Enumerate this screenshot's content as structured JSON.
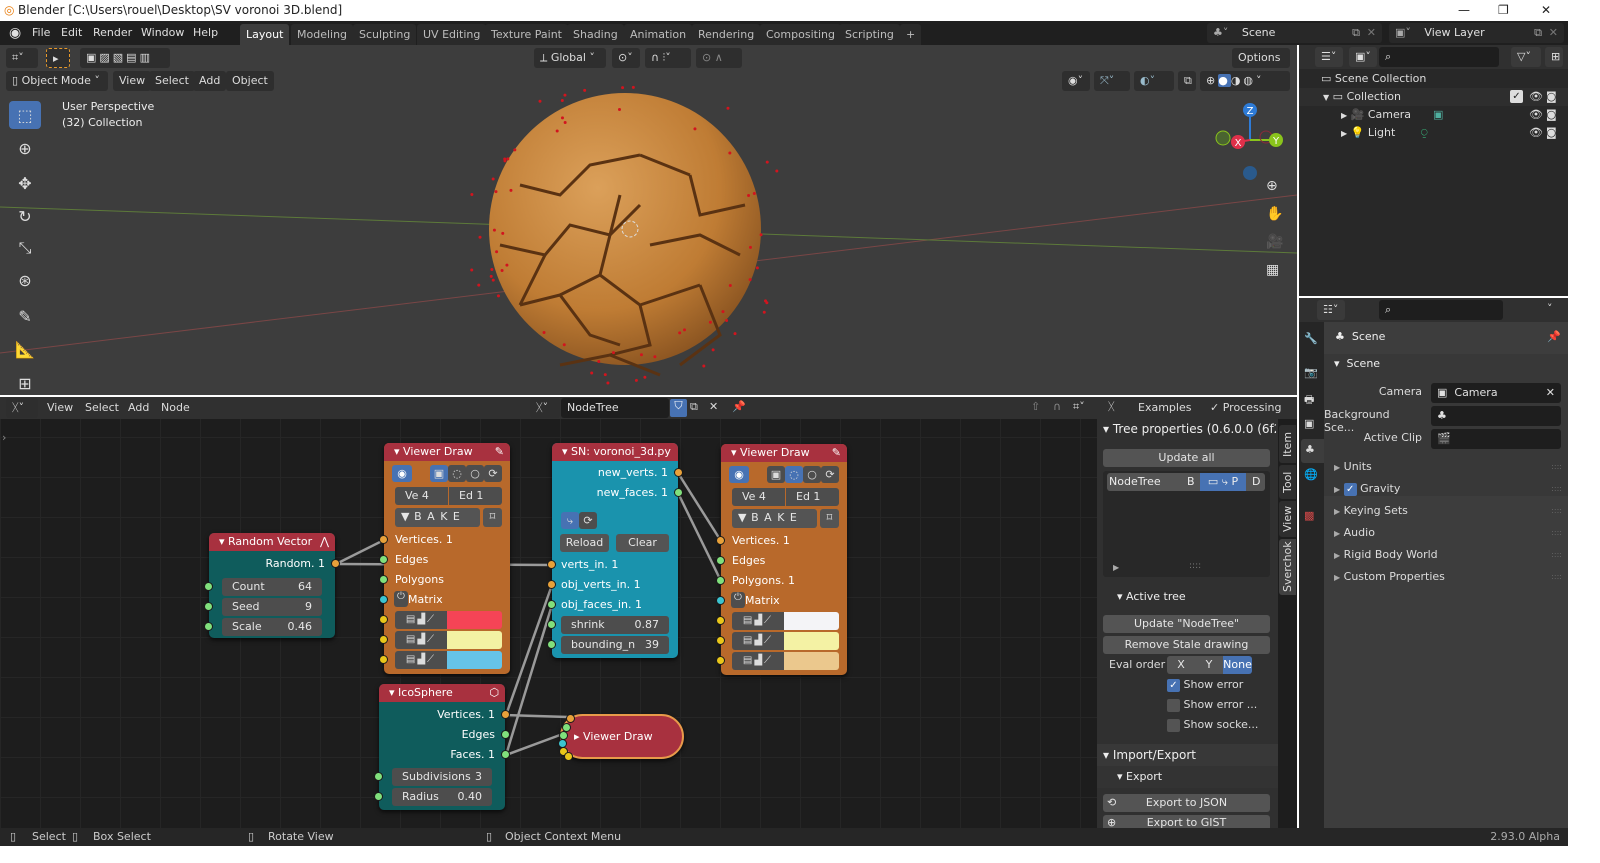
{
  "window": {
    "title": "Blender [C:\\Users\\rouel\\Desktop\\SV voronoi 3D.blend]",
    "minimize": "—",
    "restore": "❐",
    "close": "✕"
  },
  "menu": [
    "File",
    "Edit",
    "Render",
    "Window",
    "Help"
  ],
  "workspaces": [
    {
      "label": "Layout",
      "active": true
    },
    {
      "label": "Modeling"
    },
    {
      "label": "Sculpting"
    },
    {
      "label": "UV Editing"
    },
    {
      "label": "Texture Paint"
    },
    {
      "label": "Shading"
    },
    {
      "label": "Animation"
    },
    {
      "label": "Rendering"
    },
    {
      "label": "Compositing"
    },
    {
      "label": "Scripting"
    },
    {
      "label": "+"
    }
  ],
  "scene": "Scene",
  "view_layer": "View Layer",
  "viewport": {
    "transform_orientation": "Global",
    "options": "Options",
    "mode": "Object Mode",
    "menu": [
      "View",
      "Select",
      "Add",
      "Object"
    ],
    "overlay_title": "User Perspective",
    "overlay_collection": "(32) Collection",
    "gizmo": {
      "x": "X",
      "y": "Y",
      "z": "Z"
    },
    "object_color": "#c8842e"
  },
  "outliner": {
    "items": [
      {
        "label": "Scene Collection"
      },
      {
        "label": "Collection",
        "checked": true
      },
      {
        "label": "Camera"
      },
      {
        "label": "Light"
      }
    ]
  },
  "node_editor": {
    "menu": [
      "View",
      "Select",
      "Add",
      "Node"
    ],
    "tree_name": "NodeTree",
    "examples": "Examples",
    "processing": "Processing"
  },
  "nodes": {
    "random_vector": {
      "title": "Random Vector",
      "output": "Random. 1",
      "count_label": "Count",
      "count": "64",
      "seed_label": "Seed",
      "seed": "9",
      "scale_label": "Scale",
      "scale": "0.46"
    },
    "viewer1": {
      "title": "Viewer Draw",
      "ve": "Ve  4",
      "ed": "Ed  1",
      "bake": "B A K E",
      "inputs": [
        "Vertices. 1",
        "Edges",
        "Polygons",
        "Matrix"
      ],
      "colors": [
        "#f54456",
        "#f3f1a3",
        "#66c3e8"
      ]
    },
    "script": {
      "title": "SN: voronoi_3d.py",
      "outputs": [
        "new_verts. 1",
        "new_faces. 1"
      ],
      "reload": "Reload",
      "clear": "Clear",
      "inputs": [
        "verts_in. 1",
        "obj_verts_in. 1",
        "obj_faces_in. 1"
      ],
      "shrink_label": "shrink",
      "shrink": "0.87",
      "bounding_label": "bounding_n",
      "bounding": "39"
    },
    "viewer2": {
      "title": "Viewer Draw",
      "ve": "Ve  4",
      "ed": "Ed  1",
      "bake": "B A K E",
      "inputs": [
        "Vertices. 1",
        "Edges",
        "Polygons. 1",
        "Matrix"
      ],
      "colors": [
        "#f4f4f7",
        "#f4f2a4",
        "#ebc88d"
      ]
    },
    "icosphere": {
      "title": "IcoSphere",
      "outputs": [
        "Vertices. 1",
        "Edges",
        "Faces. 1"
      ],
      "subdiv_label": "Subdivisions",
      "subdiv": "3",
      "radius_label": "Radius",
      "radius": "0.40"
    },
    "viewer_collapsed": {
      "title": "Viewer Draw"
    }
  },
  "npanel": {
    "tree_props": "Tree properties (0.6.0.0 (6f29c",
    "update_all": "Update all",
    "tree_list_item": "NodeTree",
    "tree_flags": [
      "B",
      "P",
      "D"
    ],
    "active_tree": "Active tree",
    "update_tree": "Update \"NodeTree\"",
    "remove_stale": "Remove Stale drawing",
    "eval_order": "Eval order",
    "eval_options": [
      "X",
      "Y",
      "None"
    ],
    "eval_selected": "None",
    "checks": [
      {
        "label": "Show error",
        "checked": true
      },
      {
        "label": "Show error ...",
        "checked": false
      },
      {
        "label": "Show socke...",
        "checked": false
      }
    ],
    "import_export": "Import/Export",
    "export": "Export",
    "export_json": "Export to JSON",
    "export_gist": "Export to GIST",
    "tabs": [
      "Item",
      "Tool",
      "View",
      "Sverchok"
    ]
  },
  "properties": {
    "context": "Scene",
    "section": "Scene",
    "camera_label": "Camera",
    "camera": "Camera",
    "background_label": "Background Sce...",
    "active_clip_label": "Active Clip",
    "panels": [
      {
        "label": "Units"
      },
      {
        "label": "Gravity",
        "checked": true
      },
      {
        "label": "Keying Sets"
      },
      {
        "label": "Audio"
      },
      {
        "label": "Rigid Body World"
      },
      {
        "label": "Custom Properties"
      }
    ]
  },
  "status": {
    "select": "Select",
    "box_select": "Box Select",
    "rotate": "Rotate View",
    "context_menu": "Object Context Menu",
    "version": "2.93.0 Alpha"
  }
}
